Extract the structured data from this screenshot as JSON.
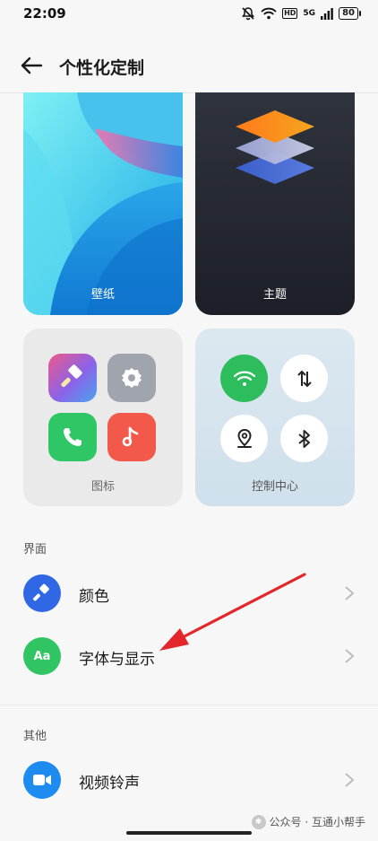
{
  "status_bar": {
    "time": "22:09",
    "mute_icon": "mute-bell-icon",
    "wifi_icon": "wifi-icon",
    "hd_tag": "HD",
    "network": "5G",
    "battery": "80"
  },
  "nav": {
    "title": "个性化定制",
    "back_icon": "arrow-left-icon"
  },
  "tiles": {
    "wallpaper": "壁纸",
    "theme": "主题",
    "icons": "图标",
    "control_center": "控制中心"
  },
  "sections": {
    "interface": "界面",
    "other": "其他"
  },
  "rows": {
    "color": "颜色",
    "font_display": "字体与显示",
    "font_icon_text": "Aa",
    "video_ringtone": "视频铃声"
  },
  "watermark": {
    "text": "公众号 · 互通小帮手"
  },
  "colors": {
    "accent_blue": "#2f67e4",
    "accent_green": "#31c463",
    "video_blue": "#1e8bf0",
    "annotation_red": "#e3262a"
  }
}
